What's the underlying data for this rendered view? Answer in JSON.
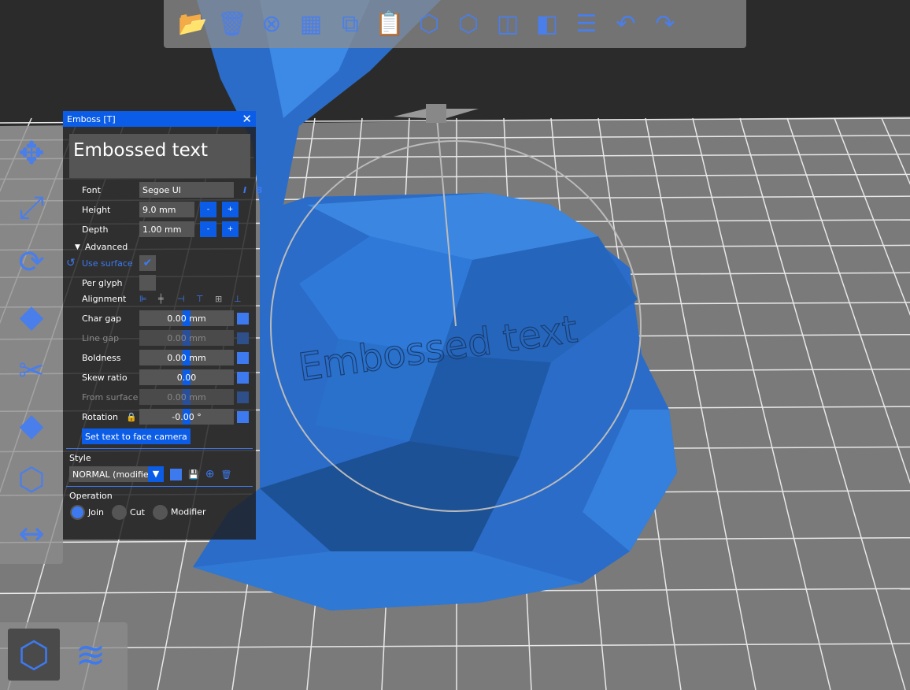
{
  "toolbar": {
    "icons": [
      "open-folder-icon",
      "delete-icon",
      "delete-all-icon",
      "arrange-icon",
      "copy-icon",
      "paste-icon",
      "add-instance-icon",
      "remove-instance-icon",
      "split-objects-icon",
      "split-parts-icon",
      "layers-editing-icon",
      "undo-icon",
      "redo-icon"
    ]
  },
  "left_toolbar": {
    "icons": [
      "move-icon",
      "scale-icon",
      "rotate-icon",
      "place-on-face-icon",
      "cut-icon",
      "paint-supports-icon",
      "seam-icon",
      "measure-icon"
    ]
  },
  "view_toggle": {
    "icons": [
      "3d-view-icon",
      "preview-layers-icon"
    ]
  },
  "viewport": {
    "embossed_label": "Embossed text"
  },
  "emboss": {
    "title": "Emboss [T]",
    "text": "Embossed text",
    "font_label": "Font",
    "font": "Segoe UI",
    "height_label": "Height",
    "height": "9.0 mm",
    "depth_label": "Depth",
    "depth": "1.00 mm",
    "minus": "-",
    "plus": "+",
    "advanced": "Advanced",
    "use_surface": "Use surface",
    "use_surface_checked": true,
    "per_glyph": "Per glyph",
    "per_glyph_checked": false,
    "alignment": "Alignment",
    "char_gap_label": "Char gap",
    "char_gap": "0.00 mm",
    "line_gap_label": "Line gap",
    "line_gap": "0.00 mm",
    "boldness_label": "Boldness",
    "boldness": "0.00 mm",
    "skew_label": "Skew ratio",
    "skew": "0.00",
    "from_surface_label": "From surface",
    "from_surface": "0.00 mm",
    "rotation_label": "Rotation",
    "rotation": "-0.00 °",
    "face_camera": "Set text to face camera",
    "style_label": "Style",
    "style": "NORMAL (modified)",
    "operation_label": "Operation",
    "operations": [
      "Join",
      "Cut",
      "Modifier"
    ],
    "operation_selected": "Join"
  }
}
